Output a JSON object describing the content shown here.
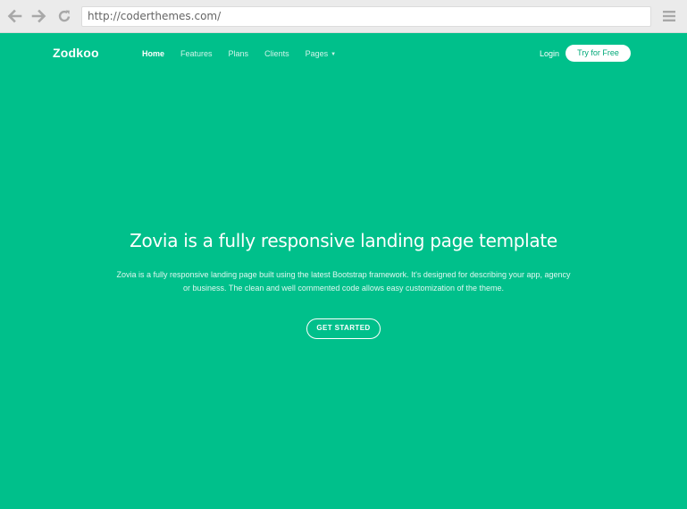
{
  "browser": {
    "url": "http://coderthemes.com/",
    "icons": [
      "back-arrow-icon",
      "forward-arrow-icon",
      "reload-icon",
      "hamburger-menu-icon"
    ]
  },
  "site": {
    "brand": "Zodkoo",
    "nav": [
      {
        "label": "Home",
        "active": true
      },
      {
        "label": "Features"
      },
      {
        "label": "Plans"
      },
      {
        "label": "Clients"
      },
      {
        "label": "Pages"
      }
    ],
    "login": "Login",
    "cta_top": "Try for Free"
  },
  "hero": {
    "title": "Zovia is a fully responsive landing page template",
    "description": "Zovia is a fully responsive landing page built using the latest Bootstrap framework. It's designed for describing your app, agency or business. The clean and well commented code allows easy customization of the theme.",
    "button": "GET STARTED"
  },
  "colors": {
    "accent": "#00c08b",
    "chrome": "#ebebeb"
  }
}
